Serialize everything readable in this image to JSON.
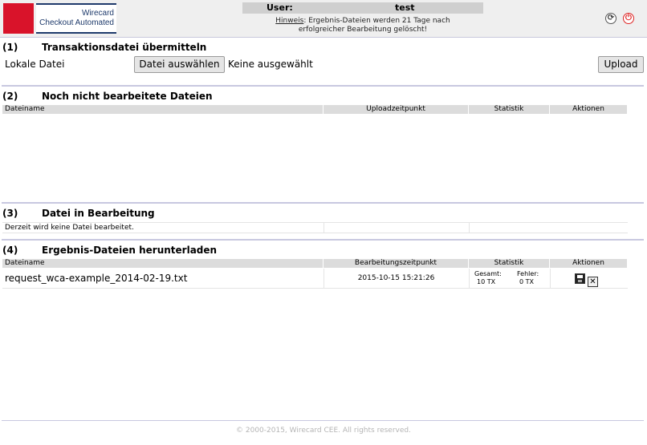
{
  "header": {
    "logo_line1": "Wirecard",
    "logo_line2": "Checkout Automated",
    "user_label": "User:",
    "user_value": "test",
    "hint_label": "Hinweis",
    "hint_text": ": Ergebnis-Dateien werden 21 Tage nach",
    "hint_text2": "erfolgreicher Bearbeitung gelöscht!",
    "icons": {
      "refresh": "refresh-icon",
      "power": "power-icon"
    },
    "colors": {
      "logo_red": "#d9132a",
      "logo_blue": "#1e3a6b",
      "power_red": "#d22222"
    }
  },
  "section1": {
    "num": "(1)",
    "title": "Transaktionsdatei übermitteln",
    "local_label": "Lokale Datei",
    "choose_button": "Datei auswählen",
    "no_file": "Keine ausgewählt",
    "upload_button": "Upload"
  },
  "section2": {
    "num": "(2)",
    "title": "Noch nicht bearbeitete Dateien",
    "columns": [
      "Dateiname",
      "Uploadzeitpunkt",
      "Statistik",
      "Aktionen"
    ]
  },
  "section3": {
    "num": "(3)",
    "title": "Datei in Bearbeitung",
    "empty_text": "Derzeit wird keine Datei bearbeitet."
  },
  "section4": {
    "num": "(4)",
    "title": "Ergebnis-Dateien herunterladen",
    "columns": [
      "Dateiname",
      "Bearbeitungszeitpunkt",
      "Statistik",
      "Aktionen"
    ],
    "rows": [
      {
        "filename": "request_wca-example_2014-02-19.txt",
        "date": "2015-10-15 15:21:26",
        "total_label": "Gesamt:",
        "total_value": "10 TX",
        "error_label": "Fehler:",
        "error_value": "0 TX",
        "save_icon": "save-icon",
        "delete_icon": "delete-icon"
      }
    ]
  },
  "footer": {
    "text": "© 2000-2015, Wirecard CEE. All rights reserved."
  }
}
